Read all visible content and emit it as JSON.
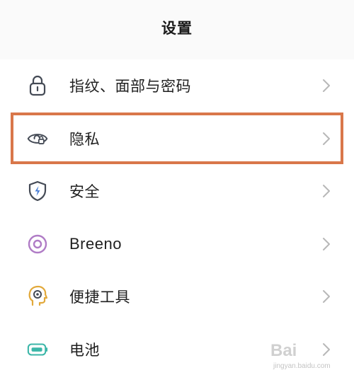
{
  "header": {
    "title": "设置"
  },
  "colors": {
    "highlight_border": "#d9774a",
    "icon_dark": "#444a55",
    "icon_purple": "#b07cc6",
    "icon_gold": "#e2a93b",
    "icon_teal": "#3bb6a8",
    "chevron": "#b8b8b8"
  },
  "items": [
    {
      "label": "指纹、面部与密码",
      "icon": "lock-icon"
    },
    {
      "label": "隐私",
      "icon": "eye-lock-icon"
    },
    {
      "label": "安全",
      "icon": "shield-bolt-icon"
    },
    {
      "label": "Breeno",
      "icon": "breeno-ring-icon"
    },
    {
      "label": "便捷工具",
      "icon": "head-target-icon"
    },
    {
      "label": "电池",
      "icon": "battery-icon"
    }
  ],
  "watermark": {
    "main": "Bai",
    "sub": "jingyan.baidu.com"
  }
}
